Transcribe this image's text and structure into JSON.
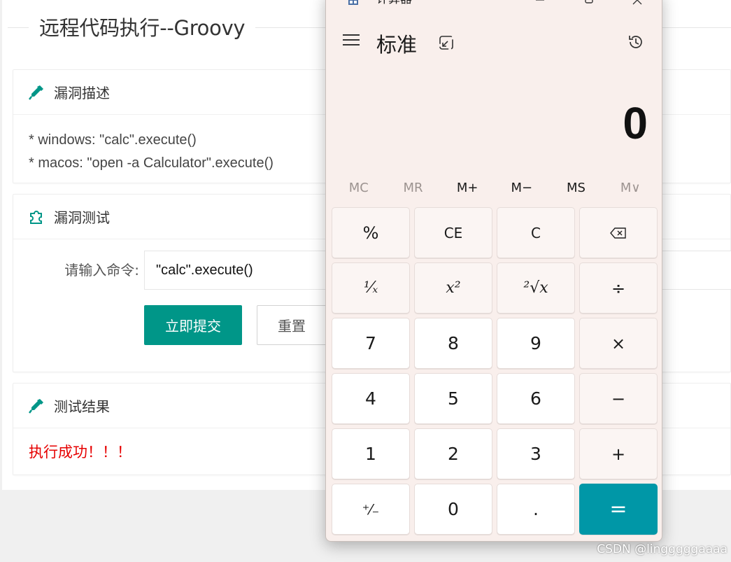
{
  "page": {
    "title": "远程代码执行--Groovy"
  },
  "vuln_desc": {
    "heading": "漏洞描述",
    "lines": [
      "* windows: \"calc\".execute()",
      "* macos: \"open -a Calculator\".execute()"
    ]
  },
  "vuln_test": {
    "heading": "漏洞测试",
    "input_label": "请输入命令:",
    "input_value": "\"calc\".execute()",
    "submit_label": "立即提交",
    "reset_label": "重置"
  },
  "result": {
    "heading": "测试结果",
    "message": "执行成功！！！"
  },
  "calculator": {
    "window_title": "计算器",
    "mode": "标准",
    "display": "0",
    "memory": [
      "MC",
      "MR",
      "M+",
      "M−",
      "MS",
      "M∨"
    ],
    "keys": {
      "percent": "%",
      "ce": "CE",
      "c": "C",
      "backspace": "⌫",
      "reciprocal": "¹⁄ₓ",
      "square": "x²",
      "sqrt": "²√x",
      "divide": "÷",
      "seven": "7",
      "eight": "8",
      "nine": "9",
      "multiply": "×",
      "four": "4",
      "five": "5",
      "six": "6",
      "minus": "−",
      "one": "1",
      "two": "2",
      "three": "3",
      "plus": "+",
      "negate": "⁺⁄₋",
      "zero": "0",
      "decimal": ".",
      "equals": "="
    },
    "accent_color": "#0097a7"
  },
  "watermark": "CSDN @lingggggaaaa",
  "colors": {
    "primary_button": "#009688",
    "success_text": "#e60000"
  }
}
